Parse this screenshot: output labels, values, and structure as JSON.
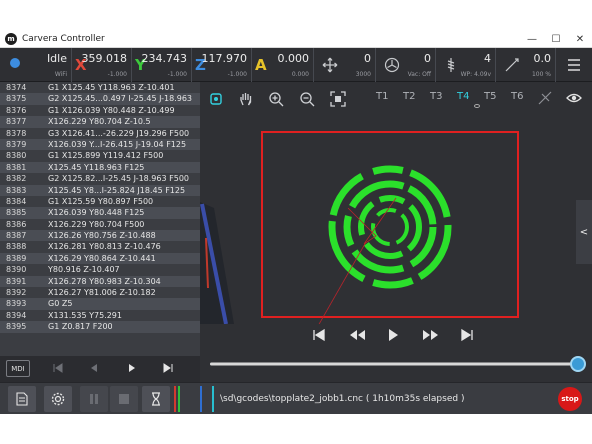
{
  "window": {
    "title": "Carvera Controller",
    "minimize": "—",
    "maximize": "☐",
    "close": "✕"
  },
  "status": {
    "state": "Idle",
    "connection": "WiFi",
    "x": {
      "axis": "X",
      "value": "359.018",
      "sub": "-1.000",
      "color": "#e0483a"
    },
    "y": {
      "axis": "Y",
      "value": "234.743",
      "sub": "-1.000",
      "color": "#3cc93c"
    },
    "z": {
      "axis": "Z",
      "value": "117.970",
      "sub": "-1.000",
      "color": "#3d8de0"
    },
    "a": {
      "axis": "A",
      "value": "0.000",
      "sub": "0.000",
      "color": "#e6c229"
    },
    "feed": {
      "value": "0",
      "sub": "3000"
    },
    "spindle": {
      "value": "0",
      "sub": "Vac: Off"
    },
    "tool": {
      "value": "4",
      "sub": "WP: 4.09v"
    },
    "laser": {
      "value": "0.0",
      "sub": "100 %"
    }
  },
  "gcode": [
    {
      "line": "8374",
      "code": "G1 X125.45 Y118.963 Z-10.401"
    },
    {
      "line": "8375",
      "code": "G2 X125.45...0.497 I-25.45 J-18.963"
    },
    {
      "line": "8376",
      "code": "G1 X126.039 Y80.448 Z-10.499"
    },
    {
      "line": "8377",
      "code": "X126.229 Y80.704 Z-10.5"
    },
    {
      "line": "8378",
      "code": "G3 X126.41...-26.229 J19.296 F500"
    },
    {
      "line": "8379",
      "code": "X126.039 Y...I-26.415 J-19.04 F125"
    },
    {
      "line": "8380",
      "code": "G1 X125.899 Y119.412 F500"
    },
    {
      "line": "8381",
      "code": "X125.45 Y118.963 F125"
    },
    {
      "line": "8382",
      "code": "G2 X125.82...I-25.45 J-18.963 F500"
    },
    {
      "line": "8383",
      "code": "X125.45 Y8...I-25.824 J18.45 F125"
    },
    {
      "line": "8384",
      "code": "G1 X125.59 Y80.897 F500"
    },
    {
      "line": "8385",
      "code": "X126.039 Y80.448 F125"
    },
    {
      "line": "8386",
      "code": "X126.229 Y80.704 F500"
    },
    {
      "line": "8387",
      "code": "X126.26 Y80.756 Z-10.488"
    },
    {
      "line": "8388",
      "code": "X126.281 Y80.813 Z-10.476"
    },
    {
      "line": "8389",
      "code": "X126.29 Y80.864 Z-10.441"
    },
    {
      "line": "8390",
      "code": "Y80.916 Z-10.407"
    },
    {
      "line": "8391",
      "code": "X126.278 Y80.983 Z-10.304"
    },
    {
      "line": "8392",
      "code": "X126.27 Y81.006 Z-10.182"
    },
    {
      "line": "8393",
      "code": "G0 Z5"
    },
    {
      "line": "8394",
      "code": "X131.535 Y75.291"
    },
    {
      "line": "8395",
      "code": "G1 Z0.817 F200"
    }
  ],
  "viewer": {
    "tools": [
      "T1",
      "T2",
      "T3",
      "T4",
      "T5",
      "T6"
    ],
    "active_tool": "T4",
    "side_tab": "<",
    "progress": 1.0,
    "accent": "#33d1e0",
    "toolpath_color": "#2be02b",
    "frame_color": "#e02020"
  },
  "controls": {
    "mdi": "MDI"
  },
  "job": {
    "file_text": "\\sd\\gcodes\\topplate2_jobb1.cnc ( 1h10m35s elapsed )",
    "stop": "stop"
  }
}
